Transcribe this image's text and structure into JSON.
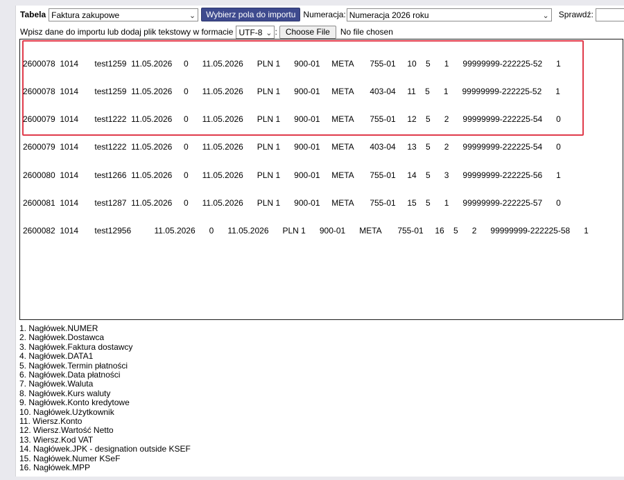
{
  "toolbar": {
    "table_label": "Tabela",
    "table_value": "Faktura zakupowe",
    "select_fields_button": "Wybierz pola do importu",
    "numbering_label": "Numeracja:",
    "numbering_value": "Numeracja 2026 roku",
    "check_label": "Sprawdź:",
    "check_value": ""
  },
  "import": {
    "instruction": "Wpisz dane do importu lub dodaj plik tekstowy w formacie",
    "encoding_value": "UTF-8",
    "choose_file_button": "Choose File",
    "file_status": "No file chosen"
  },
  "import_lines": [
    "2600078  1014       test1259  11.05.2026     0      11.05.2026      PLN 1      900-01     META       755-01     10    5      1      99999999-222225-52      1",
    "2600078  1014       test1259  11.05.2026     0      11.05.2026      PLN 1      900-01     META       403-04     11    5      1      99999999-222225-52      1",
    "2600079  1014       test1222  11.05.2026     0      11.05.2026      PLN 1      900-01     META       755-01     12    5      2      99999999-222225-54      0",
    "2600079  1014       test1222  11.05.2026     0      11.05.2026      PLN 1      900-01     META       403-04     13    5      2      99999999-222225-54      0",
    "2600080  1014       test1266  11.05.2026     0      11.05.2026      PLN 1      900-01     META       755-01     14    5      3      99999999-222225-56      1",
    "2600081  1014       test1287  11.05.2026     0      11.05.2026      PLN 1      900-01     META       755-01     15    5      1      99999999-222225-57      0",
    "2600082  1014       test12956          11.05.2026      0      11.05.2026      PLN 1      900-01      META       755-01     16    5      2      99999999-222225-58      1"
  ],
  "fields": [
    "1. Nagłówek.NUMER",
    "2. Nagłówek.Dostawca",
    "3. Nagłówek.Faktura dostawcy",
    "4. Nagłówek.DATA1",
    "5. Nagłówek.Termin płatności",
    "6. Nagłówek.Data płatności",
    "7. Nagłówek.Waluta",
    "8. Nagłówek.Kurs waluty",
    "9. Nagłówek.Konto kredytowe",
    "10. Nagłówek.Użytkownik",
    "11. Wiersz.Konto",
    "12. Wiersz.Wartość Netto",
    "13. Wiersz.Kod VAT",
    "14. Nagłówek.JPK - designation outside KSEF",
    "15. Nagłówek.Numer KSeF",
    "16. Nagłówek.MPP"
  ],
  "colors": {
    "primary_button": "#3e4a8e",
    "highlight_border": "#e03a4a"
  }
}
